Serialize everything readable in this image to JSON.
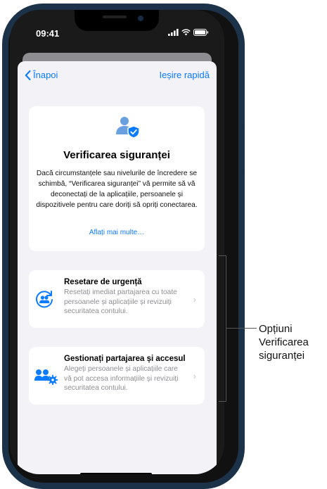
{
  "status_bar": {
    "time": "09:41"
  },
  "nav": {
    "back_label": "Înapoi",
    "quick_exit_label": "Ieșire rapidă"
  },
  "info_card": {
    "icon": "person-shield-icon",
    "title": "Verificarea siguranței",
    "body": "Dacă circumstanțele sau nivelurile de încredere se schimbă, “Verificarea siguranței” vă permite să vă deconectați de la aplicațiile, persoanele și dispozitivele pentru care doriți să opriți conectarea.",
    "link": "Aflați mai multe…"
  },
  "options": [
    {
      "icon": "emergency-reset-icon",
      "title": "Resetare de urgență",
      "description": "Resetați imediat partajarea cu toate persoanele și aplicațiile și revizuiți securitatea contului."
    },
    {
      "icon": "manage-sharing-icon",
      "title": "Gestionați partajarea și accesul",
      "description": "Alegeți persoanele și aplicațiile care vă pot accesa informațiile și revizuiți securitatea contului."
    }
  ],
  "callout": {
    "line1": "Opțiuni",
    "line2": "Verificarea",
    "line3": "siguranței"
  },
  "colors": {
    "accent": "#0a7aff",
    "phone_frame": "#1c3249",
    "sheet_bg": "#f2f2f7"
  }
}
